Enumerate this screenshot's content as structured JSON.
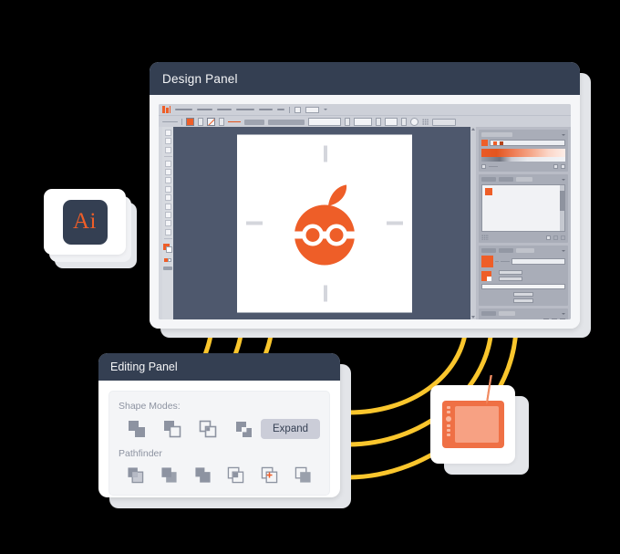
{
  "design_panel": {
    "title": "Design Panel",
    "titlebar_color": "#343f52",
    "canvas_bg": "#4e586d",
    "artboard_bg": "#ffffff",
    "app_mark": "illustrator-ai-mark",
    "menu_items": [
      "",
      "",
      "",
      "",
      "",
      ""
    ],
    "artwork": {
      "name": "orange-mascot-logo",
      "body_color": "#ee5e28",
      "leaf_color": "#ee5e28",
      "glasses_color": "#ffffff",
      "guide_color": "#d4d6dc"
    },
    "panels": [
      {
        "name": "color-panel",
        "swatch": "#ee5e28",
        "gradient": "orange-ramp"
      },
      {
        "name": "layers-preview-panel"
      },
      {
        "name": "appearance-panel",
        "swatch": "#ee5e28"
      },
      {
        "name": "align-panel"
      }
    ]
  },
  "ai_icon": {
    "label": "Ai",
    "tile_color": "#343f52",
    "text_color": "#ee5e28",
    "name": "adobe-illustrator-icon"
  },
  "editing_panel": {
    "title": "Editing Panel",
    "titlebar_color": "#343f52",
    "shape_modes_label": "Shape Modes:",
    "pathfinder_label": "Pathfinder",
    "expand_label": "Expand",
    "expand_bg": "#cbcdd8",
    "shape_mode_icons": [
      "unite-icon",
      "minus-front-icon",
      "intersect-icon",
      "exclude-icon"
    ],
    "pathfinder_icons": [
      "divide-icon",
      "trim-icon",
      "merge-icon",
      "crop-icon",
      "outline-icon",
      "minus-back-icon"
    ],
    "accent_icon_color": "#ee5e28",
    "icon_color": "#8d93a1"
  },
  "tablet": {
    "name": "drawing-tablet",
    "body_color": "#ef7045",
    "screen_color": "#f7a183",
    "stylus_color": "#ef7b52"
  },
  "connectors": {
    "color": "#fac62d",
    "count": 6,
    "name": "yellow-connector-wires"
  },
  "background": "#000000"
}
